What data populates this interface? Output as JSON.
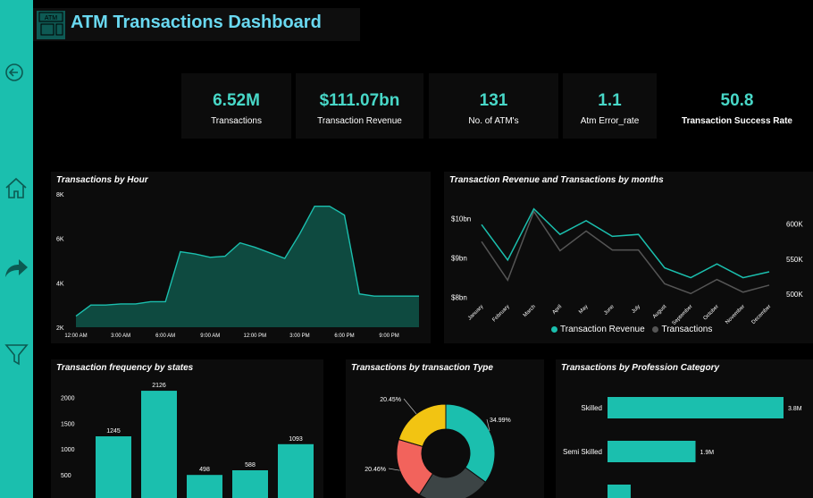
{
  "header": {
    "title": "ATM Transactions Dashboard",
    "logo_text": "ATM"
  },
  "sidebar": {
    "icons": [
      "back-icon",
      "home-icon",
      "forward-icon",
      "filter-icon"
    ]
  },
  "kpis": [
    {
      "value": "6.52M",
      "label": "Transactions"
    },
    {
      "value": "$111.07bn",
      "label": "Transaction Revenue"
    },
    {
      "value": "131",
      "label": "No. of ATM's"
    },
    {
      "value": "1.1",
      "label": "Atm Error_rate"
    },
    {
      "value": "50.8",
      "label": "Transaction Success Rate"
    }
  ],
  "colors": {
    "accent": "#1bbfae",
    "area_fill": "#0e4a40",
    "series_gray": "#555555",
    "pie_yellow": "#f2c412",
    "pie_red": "#f2635c",
    "pie_dark": "#3c4445"
  },
  "chart_data": [
    {
      "type": "area",
      "title": "Transactions by Hour",
      "x_ticks": [
        "12:00 AM",
        "3:00 AM",
        "6:00 AM",
        "9:00 AM",
        "12:00 PM",
        "3:00 PM",
        "6:00 PM",
        "9:00 PM"
      ],
      "y_ticks": [
        "2K",
        "4K",
        "6K",
        "8K"
      ],
      "ylim": [
        2000,
        8000
      ],
      "x": [
        0,
        1,
        2,
        3,
        4,
        5,
        6,
        7,
        8,
        9,
        10,
        11,
        12,
        13,
        14,
        15,
        16,
        17,
        18,
        19,
        20,
        21,
        22,
        23
      ],
      "values": [
        2500,
        3000,
        3000,
        3050,
        3050,
        3150,
        3150,
        5400,
        5300,
        5150,
        5200,
        5800,
        5600,
        5350,
        5100,
        6200,
        7450,
        7450,
        7050,
        3500,
        3400,
        3400,
        3400,
        3400
      ]
    },
    {
      "type": "line",
      "title": "Transaction Revenue and Transactions by months",
      "categories": [
        "January",
        "February",
        "March",
        "April",
        "May",
        "June",
        "July",
        "August",
        "September",
        "October",
        "November",
        "December"
      ],
      "left_ticks": [
        "$8bn",
        "$9bn",
        "$10bn"
      ],
      "right_ticks": [
        "500K",
        "550K",
        "600K"
      ],
      "ylim_left": [
        7.9,
        10.4
      ],
      "ylim_right": [
        490,
        630
      ],
      "series": [
        {
          "name": "Transaction Revenue",
          "axis": "left",
          "values": [
            9.85,
            8.95,
            10.25,
            9.6,
            9.95,
            9.55,
            9.6,
            8.75,
            8.5,
            8.85,
            8.5,
            8.65
          ]
        },
        {
          "name": "Transactions",
          "axis": "right",
          "values": [
            575,
            520,
            618,
            562,
            590,
            563,
            563,
            515,
            501,
            521,
            503,
            513
          ]
        }
      ]
    },
    {
      "type": "bar",
      "title": "Transaction frequency by states",
      "y_ticks": [
        "500",
        "1000",
        "1500",
        "2000"
      ],
      "ylim": [
        0,
        2300
      ],
      "values": [
        1245,
        2126,
        498,
        588,
        1093
      ],
      "labels": [
        "1245",
        "2126",
        "498",
        "588",
        "1093"
      ]
    },
    {
      "type": "pie",
      "title": "Transactions by transaction Type",
      "slices": [
        {
          "value": 34.99,
          "label": "34.99%"
        },
        {
          "value": 24.1,
          "label": ""
        },
        {
          "value": 20.46,
          "label": "20.46%"
        },
        {
          "value": 20.45,
          "label": "20.45%"
        }
      ]
    },
    {
      "type": "bar",
      "title": "Transactions by Profession Category",
      "orientation": "horizontal",
      "categories": [
        "Skilled",
        "Semi Skilled",
        ""
      ],
      "values": [
        3.8,
        1.9,
        0.5
      ],
      "labels": [
        "3.8M",
        "1.9M",
        ""
      ]
    }
  ]
}
